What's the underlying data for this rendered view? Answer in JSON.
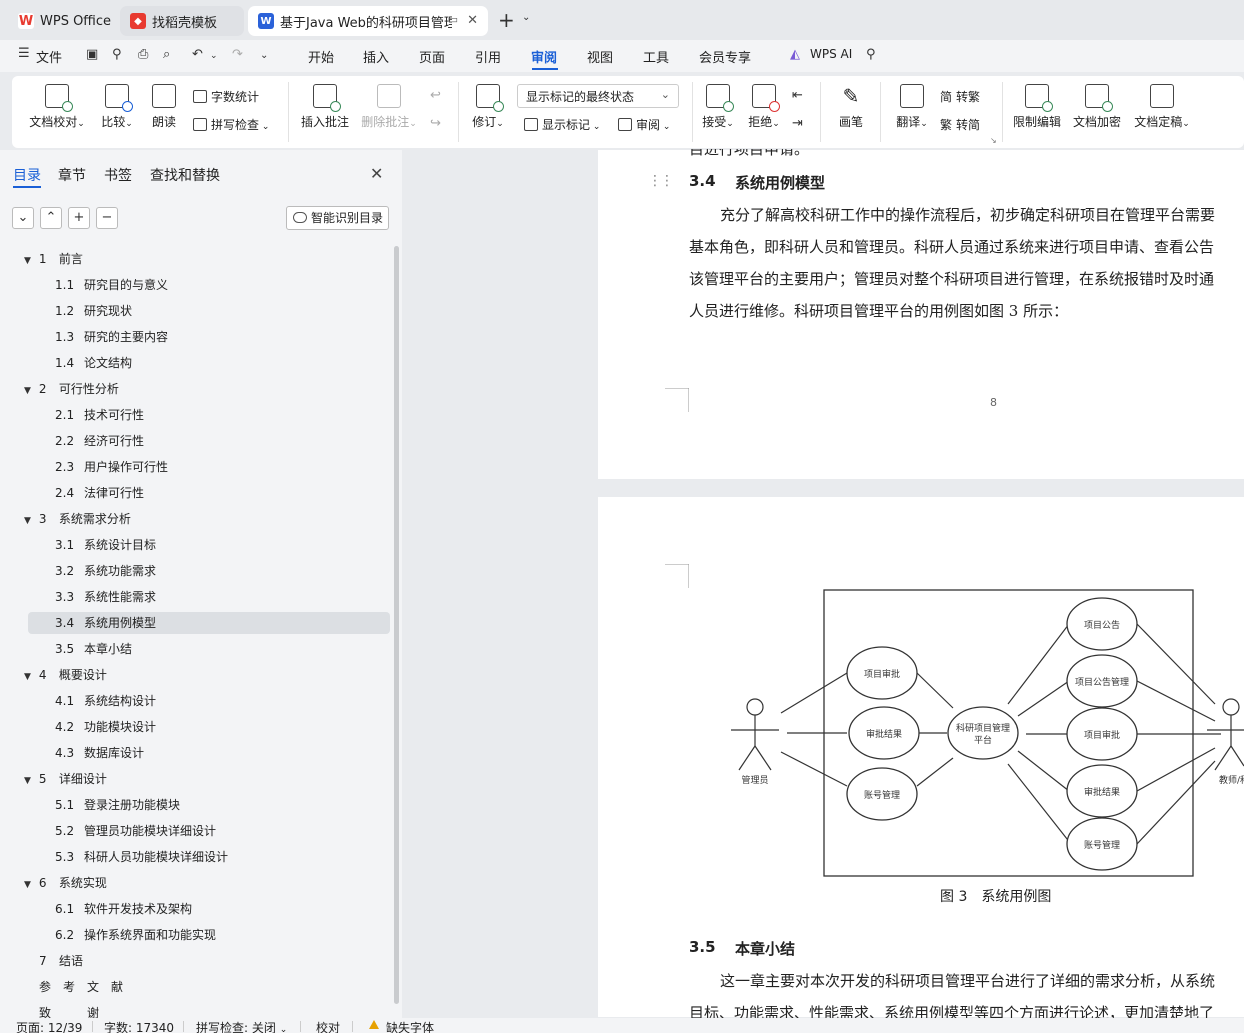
{
  "tabs": [
    {
      "label": "WPS Office",
      "icon": "wps-logo-icon"
    },
    {
      "label": "找稻壳模板",
      "icon": "docer-icon"
    },
    {
      "label": "基于Java Web的科研项目管理",
      "icon": "word-doc-icon"
    }
  ],
  "menu": {
    "file": "文件",
    "items": [
      "开始",
      "插入",
      "页面",
      "引用",
      "审阅",
      "视图",
      "工具",
      "会员专享"
    ],
    "active": "审阅",
    "ai": "WPS AI"
  },
  "ribbon": {
    "doc_proofread": "文档校对",
    "compare": "比较",
    "read_aloud": "朗读",
    "word_count": "字数统计",
    "spell_check": "拼写检查",
    "insert_comment": "插入批注",
    "delete_comment": "删除批注",
    "track_changes": "修订",
    "markup_state": "显示标记的最终状态",
    "show_markup": "显示标记",
    "review_pane": "审阅",
    "accept": "接受",
    "reject": "拒绝",
    "pen": "画笔",
    "translate": "翻译",
    "to_traditional": "转繁",
    "to_simplified": "转简",
    "restrict_edit": "限制编辑",
    "encrypt": "文档加密",
    "finalize": "文档定稿",
    "trad_glyph": "简",
    "simp_glyph": "繁"
  },
  "panel": {
    "tabs": [
      "目录",
      "章节",
      "书签",
      "查找和替换"
    ],
    "smart_toc": "智能识别目录",
    "toc": [
      {
        "num": "1",
        "title": "前言",
        "level": 1,
        "expanded": true
      },
      {
        "num": "1.1",
        "title": "研究目的与意义",
        "level": 2
      },
      {
        "num": "1.2",
        "title": "研究现状",
        "level": 2
      },
      {
        "num": "1.3",
        "title": "研究的主要内容",
        "level": 2
      },
      {
        "num": "1.4",
        "title": "论文结构",
        "level": 2
      },
      {
        "num": "2",
        "title": "可行性分析",
        "level": 1,
        "expanded": true
      },
      {
        "num": "2.1",
        "title": "技术可行性",
        "level": 2
      },
      {
        "num": "2.2",
        "title": "经济可行性",
        "level": 2
      },
      {
        "num": "2.3",
        "title": "用户操作可行性",
        "level": 2
      },
      {
        "num": "2.4",
        "title": "法律可行性",
        "level": 2
      },
      {
        "num": "3",
        "title": "系统需求分析",
        "level": 1,
        "expanded": true
      },
      {
        "num": "3.1",
        "title": "系统设计目标",
        "level": 2
      },
      {
        "num": "3.2",
        "title": "系统功能需求",
        "level": 2
      },
      {
        "num": "3.3",
        "title": "系统性能需求",
        "level": 2
      },
      {
        "num": "3.4",
        "title": "系统用例模型",
        "level": 2,
        "selected": true
      },
      {
        "num": "3.5",
        "title": "本章小结",
        "level": 2
      },
      {
        "num": "4",
        "title": "概要设计",
        "level": 1,
        "expanded": true
      },
      {
        "num": "4.1",
        "title": "系统结构设计",
        "level": 2
      },
      {
        "num": "4.2",
        "title": "功能模块设计",
        "level": 2
      },
      {
        "num": "4.3",
        "title": "数据库设计",
        "level": 2
      },
      {
        "num": "5",
        "title": "详细设计",
        "level": 1,
        "expanded": true
      },
      {
        "num": "5.1",
        "title": "登录注册功能模块",
        "level": 2
      },
      {
        "num": "5.2",
        "title": "管理员功能模块详细设计",
        "level": 2
      },
      {
        "num": "5.3",
        "title": "科研人员功能模块详细设计",
        "level": 2
      },
      {
        "num": "6",
        "title": "系统实现",
        "level": 1,
        "expanded": true
      },
      {
        "num": "6.1",
        "title": "软件开发技术及架构",
        "level": 2
      },
      {
        "num": "6.2",
        "title": "操作系统界面和功能实现",
        "level": 2
      },
      {
        "num": "7",
        "title": "结语",
        "level": 1,
        "expanded": false
      },
      {
        "num": "",
        "title": "参　考　文　献",
        "level": 0
      },
      {
        "num": "",
        "title": "致　　　谢",
        "level": 0
      }
    ]
  },
  "document": {
    "cut_line": "目进行项目申请。",
    "section_34": {
      "num": "3.4",
      "title": "系统用例模型"
    },
    "para_34": [
      "充分了解高校科研工作中的操作流程后，初步确定科研项目在管理平台需要",
      "基本角色，即科研人员和管理员。科研人员通过系统来进行项目申请、查看公告",
      "该管理平台的主要用户；管理员对整个科研项目进行管理，在系统报错时及时通",
      "人员进行维修。科研项目管理平台的用例图如图 3 所示："
    ],
    "page_number": "8",
    "diagram": {
      "center": [
        "科研项目管理",
        "平台"
      ],
      "left_actor": "管理员",
      "right_actor": "教师/科",
      "left_uses": [
        "项目审批",
        "审批结果",
        "账号管理"
      ],
      "right_uses": [
        "项目公告",
        "项目公告管理",
        "项目审批",
        "审批结果",
        "账号管理"
      ]
    },
    "figure_caption": "图 3　系统用例图",
    "section_35": {
      "num": "3.5",
      "title": "本章小结"
    },
    "para_35": [
      "这一章主要对本次开发的科研项目管理平台进行了详细的需求分析，从系统",
      "目标、功能需求、性能需求、系统用例模型等四个方面进行论述，更加清楚地了"
    ]
  },
  "status": {
    "page": "页面: 12/39",
    "words": "字数: 17340",
    "spell": "拼写检查: 关闭",
    "proof": "校对",
    "missing_font": "缺失字体"
  },
  "colors": {
    "accent": "#1a5fd6",
    "wps_red": "#e83a30",
    "selected_row": "#dcdfe3"
  }
}
